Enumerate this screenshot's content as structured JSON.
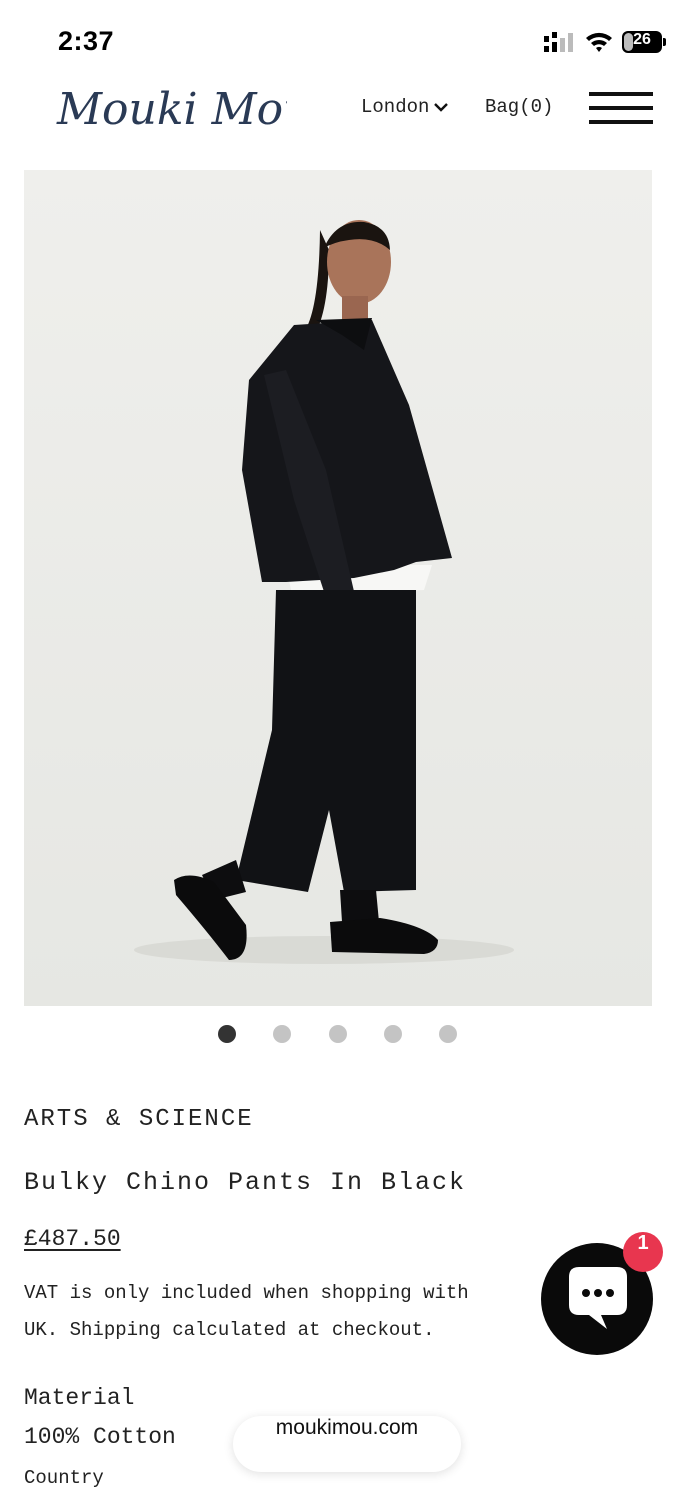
{
  "status_bar": {
    "time": "2:37",
    "battery": "26",
    "battery_level": 0.26
  },
  "header": {
    "logo_text": "Mouki Mou",
    "location": "London",
    "bag_label": "Bag",
    "bag_count": "(0)",
    "icons": {
      "location_dropdown": "chevron-down-icon",
      "menu": "hamburger-menu-icon"
    }
  },
  "gallery": {
    "image_count": 5,
    "active_index": 0
  },
  "product": {
    "brand": "ARTS & SCIENCE",
    "title": "Bulky Chino Pants In Black",
    "price": "£487.50",
    "vat_note": "VAT is only included when shopping with\nUK. Shipping calculated at checkout.",
    "material_label": "Material",
    "material_value": "100% Cotton",
    "country_label": "Country"
  },
  "chat": {
    "badge": "1",
    "icon": "chat-bubble-icon",
    "color": "#0a0a0a",
    "badge_color": "#e8364f"
  },
  "browser": {
    "url": "moukimou.com"
  }
}
